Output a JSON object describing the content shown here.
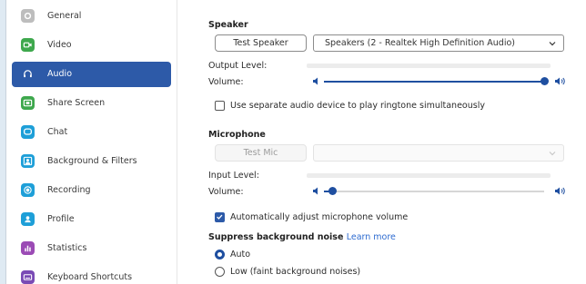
{
  "sidebar": {
    "items": [
      {
        "label": "General",
        "icon": "gear-icon",
        "color": "#bdbdbd"
      },
      {
        "label": "Video",
        "icon": "video-camera-icon",
        "color": "#3ea84d"
      },
      {
        "label": "Audio",
        "icon": "headphones-icon",
        "color": "#2d5aa8"
      },
      {
        "label": "Share Screen",
        "icon": "share-screen-icon",
        "color": "#3ea84d"
      },
      {
        "label": "Chat",
        "icon": "chat-bubble-icon",
        "color": "#1e9fd8"
      },
      {
        "label": "Background & Filters",
        "icon": "person-background-icon",
        "color": "#1e9fd8"
      },
      {
        "label": "Recording",
        "icon": "record-icon",
        "color": "#1e9fd8"
      },
      {
        "label": "Profile",
        "icon": "profile-icon",
        "color": "#1e9fd8"
      },
      {
        "label": "Statistics",
        "icon": "bar-chart-icon",
        "color": "#9b4bb5"
      },
      {
        "label": "Keyboard Shortcuts",
        "icon": "keyboard-icon",
        "color": "#7a4bb5"
      }
    ],
    "active_index": 2
  },
  "speaker": {
    "title": "Speaker",
    "test_button": "Test Speaker",
    "device": "Speakers (2 - Realtek High Definition Audio)",
    "output_level_label": "Output Level:",
    "volume_label": "Volume:",
    "volume_level": 1.0
  },
  "separate_device": {
    "label": "Use separate audio device to play ringtone simultaneously",
    "checked": false
  },
  "microphone": {
    "title": "Microphone",
    "test_button": "Test Mic",
    "device": "",
    "input_level_label": "Input Level:",
    "volume_label": "Volume:",
    "volume_level": 0.04
  },
  "auto_adjust": {
    "label": "Automatically adjust microphone volume",
    "checked": true
  },
  "noise": {
    "title": "Suppress background noise",
    "learn_more": "Learn more",
    "options": [
      {
        "label": "Auto",
        "checked": true
      },
      {
        "label": "Low (faint background noises)",
        "checked": false
      }
    ]
  },
  "colors": {
    "accent": "#2d5aa8",
    "slider": "#1f4fa0"
  }
}
